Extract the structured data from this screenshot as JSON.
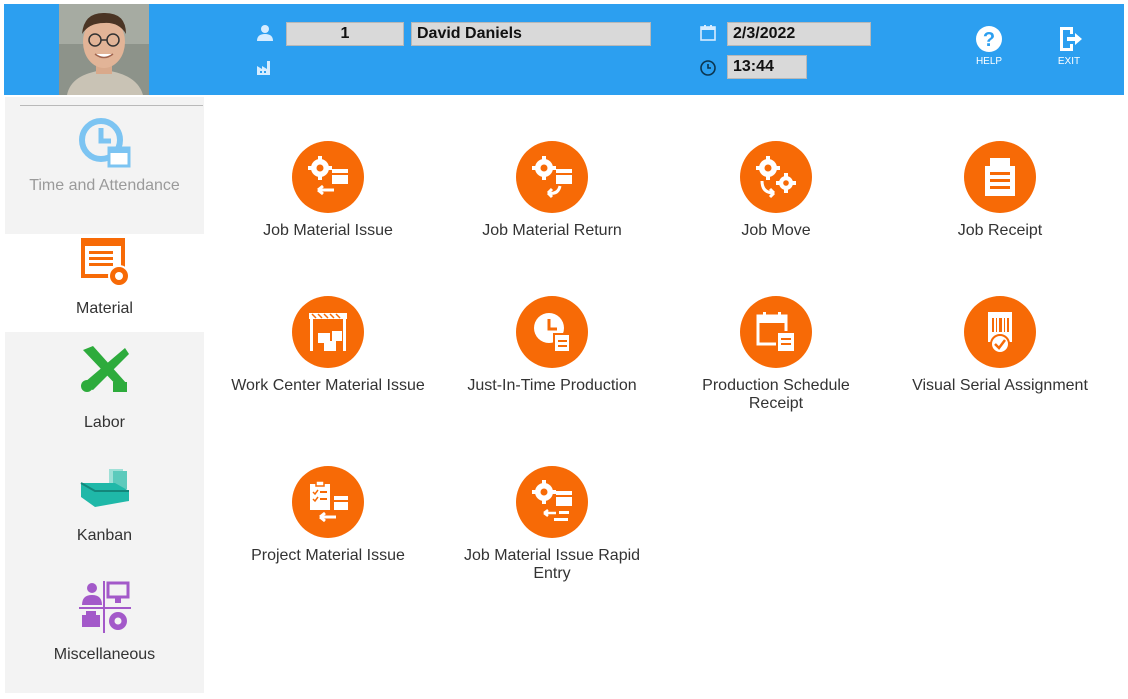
{
  "header": {
    "user_id": "1",
    "user_name": "David Daniels",
    "date": "2/3/2022",
    "time": "13:44",
    "help_label": "HELP",
    "exit_label": "EXIT"
  },
  "sidebar": {
    "items": [
      {
        "label": "Time and Attendance",
        "icon": "clock-calendar-icon",
        "color": "#7cc4f2",
        "state": "disabled"
      },
      {
        "label": "Material",
        "icon": "material-gear-icon",
        "color": "#f76a06",
        "state": "active"
      },
      {
        "label": "Labor",
        "icon": "hammer-wrench-icon",
        "color": "#2dab3c",
        "state": "normal"
      },
      {
        "label": "Kanban",
        "icon": "kanban-bin-icon",
        "color": "#1fb8a8",
        "state": "normal"
      },
      {
        "label": "Miscellaneous",
        "icon": "miscellaneous-icon",
        "color": "#a359c9",
        "state": "normal"
      }
    ]
  },
  "tiles": [
    {
      "label": "Job Material Issue",
      "icon": "gear-box-issue-icon"
    },
    {
      "label": "Job Material Return",
      "icon": "gear-box-return-icon"
    },
    {
      "label": "Job Move",
      "icon": "gears-move-icon"
    },
    {
      "label": "Job Receipt",
      "icon": "receipt-icon"
    },
    {
      "label": "Work Center Material Issue",
      "icon": "work-center-icon"
    },
    {
      "label": "Just-In-Time Production",
      "icon": "clock-document-icon"
    },
    {
      "label": "Production Schedule Receipt",
      "icon": "calendar-document-icon"
    },
    {
      "label": "Visual Serial Assignment",
      "icon": "barcode-check-icon"
    },
    {
      "label": "Project Material Issue",
      "icon": "checklist-issue-icon"
    },
    {
      "label": "Job Material Issue Rapid Entry",
      "icon": "gear-box-rapid-icon"
    }
  ],
  "colors": {
    "header_bg": "#2c9ff0",
    "tile_accent": "#f76a06",
    "sidebar_bg": "#f3f3f3"
  }
}
